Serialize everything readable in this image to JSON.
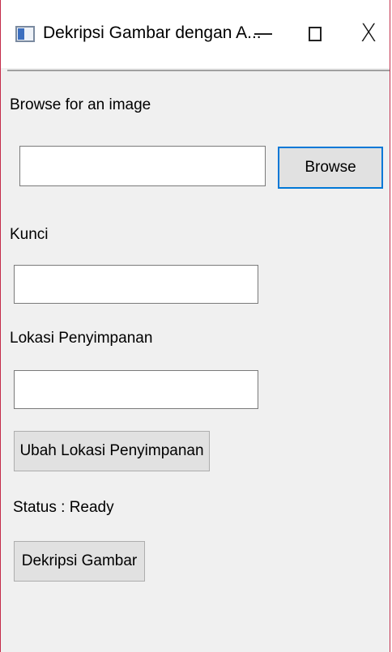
{
  "window": {
    "title": "Dekripsi Gambar dengan A...",
    "minimize_label": "",
    "maximize_label": "",
    "close_glyph": "X"
  },
  "browse": {
    "label": "Browse for an image",
    "input_value": "",
    "button_label": "Browse"
  },
  "kunci": {
    "label": "Kunci",
    "input_value": ""
  },
  "lokasi": {
    "label": "Lokasi Penyimpanan",
    "input_value": "",
    "change_button_label": "Ubah Lokasi Penyimpanan"
  },
  "status": {
    "text": "Status : Ready"
  },
  "actions": {
    "decrypt_button_label": "Dekripsi Gambar"
  },
  "icons": {
    "app": "app-window-icon",
    "minimize": "minimize-icon",
    "maximize": "maximize-icon",
    "close": "close-icon"
  },
  "colors": {
    "window_border": "#c42b4a",
    "background": "#f0f0f0",
    "button_face": "#e1e1e1",
    "focus_border": "#0078d7"
  }
}
